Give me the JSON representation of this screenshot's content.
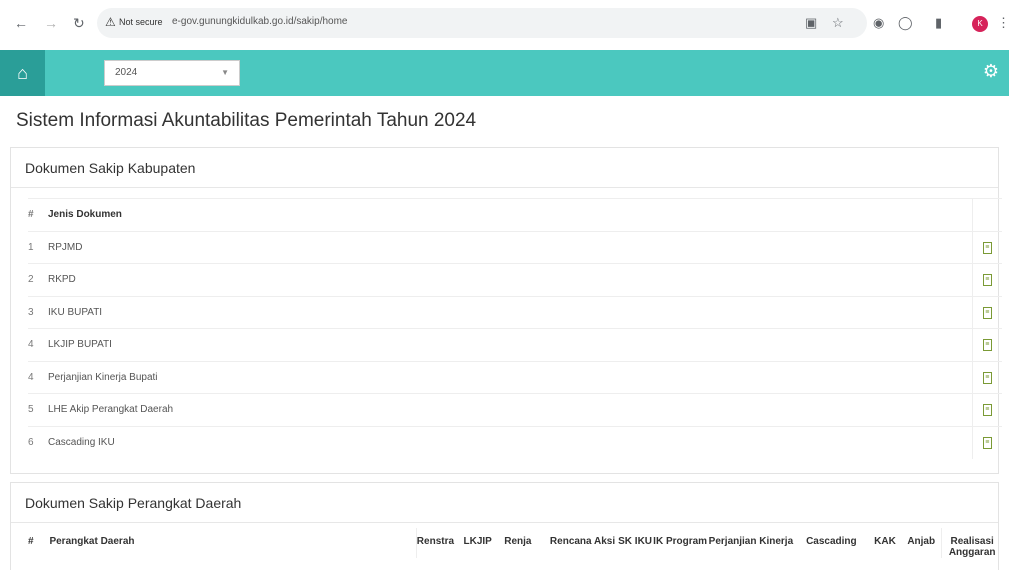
{
  "browser": {
    "not_secure": "Not secure",
    "url": "e-gov.gunungkidulkab.go.id/sakip/home",
    "profile_initial": "K"
  },
  "appbar": {
    "year": "2024"
  },
  "page": {
    "title": "Sistem Informasi Akuntabilitas Pemerintah Tahun 2024"
  },
  "kabupaten": {
    "heading": "Dokumen Sakip Kabupaten",
    "col_num": "#",
    "col_name": "Jenis Dokumen",
    "rows": [
      {
        "num": "1",
        "name": "RPJMD"
      },
      {
        "num": "2",
        "name": "RKPD"
      },
      {
        "num": "3",
        "name": "IKU BUPATI"
      },
      {
        "num": "4",
        "name": "LKJIP BUPATI"
      },
      {
        "num": "4",
        "name": "Perjanjian Kinerja Bupati"
      },
      {
        "num": "5",
        "name": "LHE Akip Perangkat Daerah"
      },
      {
        "num": "6",
        "name": "Cascading IKU"
      }
    ]
  },
  "perangkat": {
    "heading": "Dokumen Sakip Perangkat Daerah",
    "columns": [
      "#",
      "Perangkat Daerah",
      "Renstra",
      "LKJIP",
      "Renja",
      "Rencana Aksi",
      "SK IKU",
      "IK Program",
      "Perjanjian Kinerja",
      "Cascading",
      "KAK",
      "Anjab",
      "Realisasi Anggaran"
    ]
  }
}
